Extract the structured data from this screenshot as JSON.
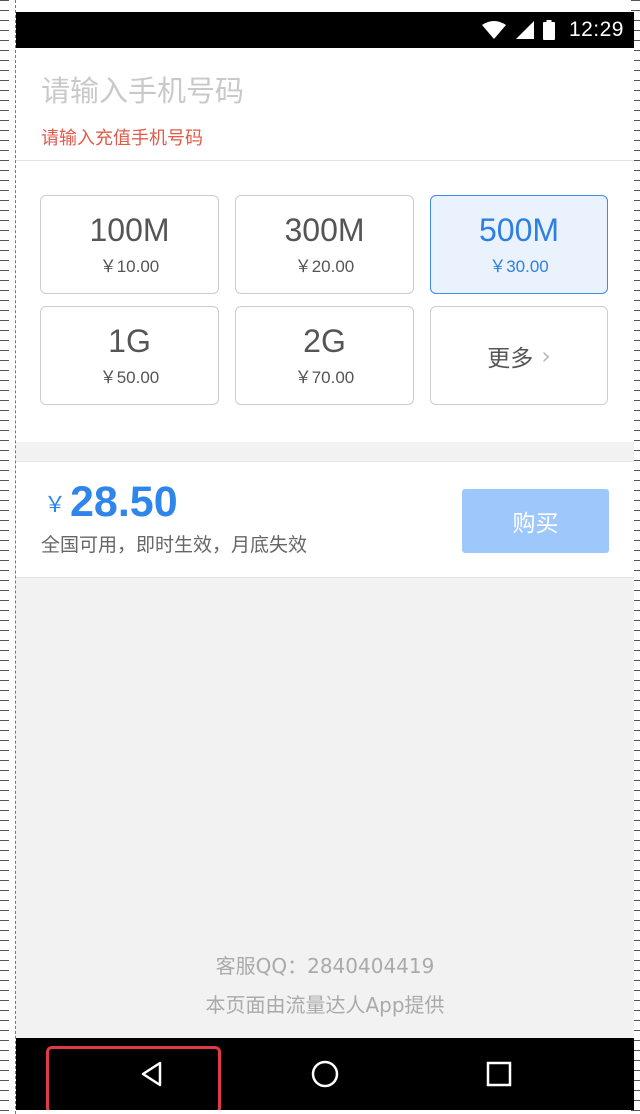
{
  "status_bar": {
    "time": "12:29",
    "icons": [
      "wifi-icon",
      "signal-icon",
      "battery-icon"
    ]
  },
  "recharge": {
    "phone_placeholder": "请输入手机号码",
    "phone_value": "",
    "hint": "请输入充值手机号码"
  },
  "packages": [
    {
      "size": "100M",
      "price": "￥10.00",
      "selected": false
    },
    {
      "size": "300M",
      "price": "￥20.00",
      "selected": false
    },
    {
      "size": "500M",
      "price": "￥30.00",
      "selected": true
    },
    {
      "size": "1G",
      "price": "￥50.00",
      "selected": false
    },
    {
      "size": "2G",
      "price": "￥70.00",
      "selected": false
    }
  ],
  "more_label": "更多",
  "purchase": {
    "currency": "￥",
    "amount": "28.50",
    "note": "全国可用，即时生效，月底失效",
    "buy_label": "购买"
  },
  "footer": {
    "service": "客服QQ：2840404419",
    "provider": "本页面由流量达人App提供"
  },
  "nav": {
    "icons": [
      "back-icon",
      "home-icon",
      "recents-icon"
    ]
  },
  "colors": {
    "accent": "#2f86ea",
    "selected_bg": "#e9f2fd",
    "hint": "#e25a4a",
    "buy_button": "#9ec8fb",
    "highlight": "#e23a44"
  }
}
